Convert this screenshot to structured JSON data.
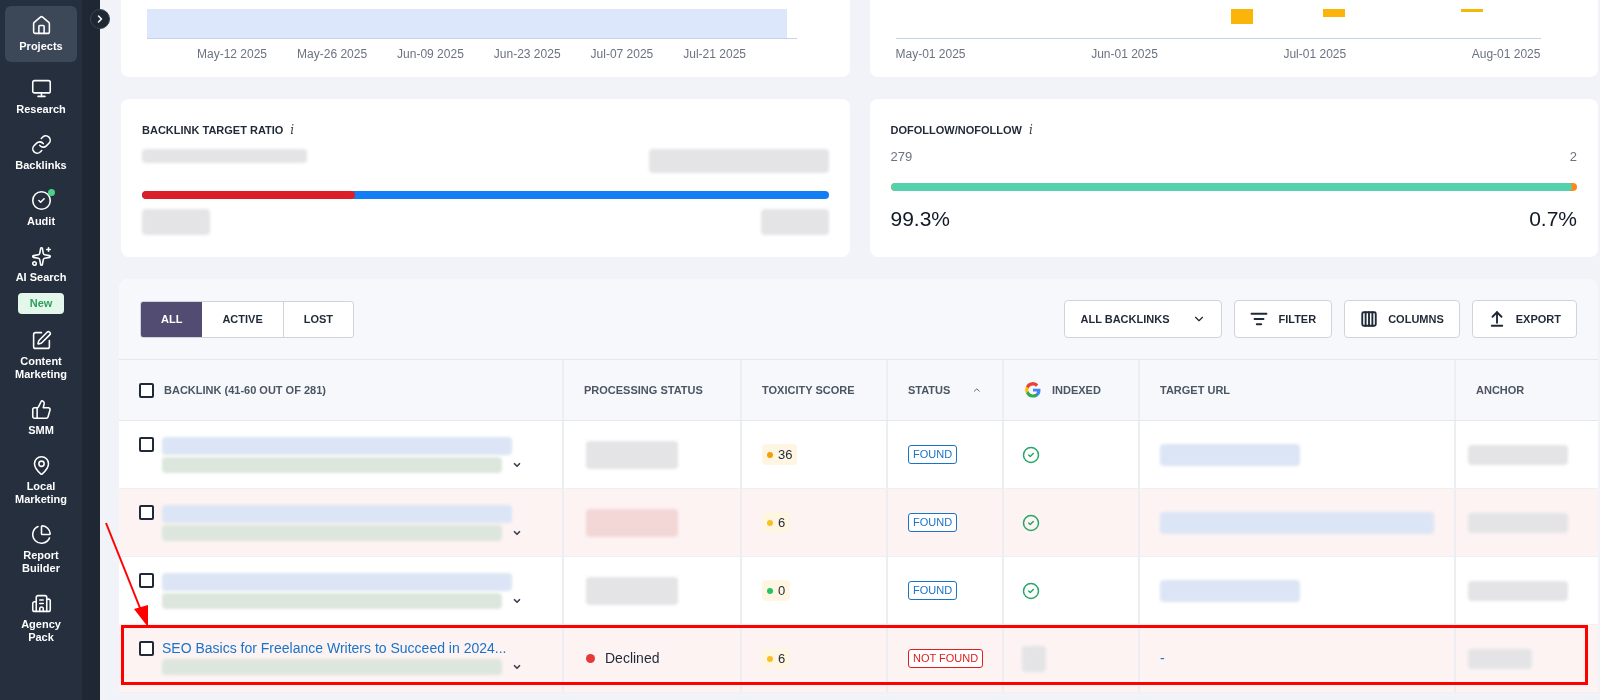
{
  "sidebar": {
    "items": [
      {
        "label": "Projects",
        "selected": true
      },
      {
        "label": "Research",
        "selected": false
      },
      {
        "label": "Backlinks",
        "selected": false
      },
      {
        "label": "Audit",
        "selected": false,
        "notification": true
      },
      {
        "label": "AI Search",
        "selected": false,
        "badge": "New"
      },
      {
        "label": "Content Marketing",
        "selected": false
      },
      {
        "label": "SMM",
        "selected": false
      },
      {
        "label": "Local Marketing",
        "selected": false
      },
      {
        "label": "Report Builder",
        "selected": false
      },
      {
        "label": "Agency Pack",
        "selected": false
      }
    ]
  },
  "top_charts": [
    {
      "kind": "area",
      "x_tick_labels": [
        "May-12 2025",
        "May-26 2025",
        "Jun-09 2025",
        "Jun-23 2025",
        "Jul-07 2025",
        "Jul-21 2025"
      ]
    },
    {
      "kind": "bars",
      "x_tick_labels": [
        "May-01 2025",
        "Jun-01 2025",
        "Jul-01 2025",
        "Aug-01 2025"
      ]
    }
  ],
  "ratio_cards": [
    {
      "title": "BACKLINK TARGET RATIO",
      "info": "i",
      "kind": "blurred",
      "level": 0.31
    },
    {
      "title": "DOFOLLOW/NOFOLLOW",
      "info": "i",
      "kind": "counts",
      "level": 0.993,
      "left_count": "279",
      "right_count": "2",
      "left_percent": "99.3%",
      "right_percent": "0.7%"
    }
  ],
  "segment_tabs": [
    {
      "label": "ALL",
      "selected": true
    },
    {
      "label": "ACTIVE",
      "selected": false
    },
    {
      "label": "LOST",
      "selected": false
    }
  ],
  "toolbar": {
    "dropdown": "ALL BACKLINKS",
    "buttons": [
      {
        "label": "FILTER",
        "kind": "filter"
      },
      {
        "label": "COLUMNS",
        "kind": "columns"
      },
      {
        "label": "EXPORT",
        "kind": "export"
      }
    ]
  },
  "table": {
    "columns": [
      {
        "label": "BACKLINK (41-60 OUT OF 281)",
        "kind": "select",
        "checked": false
      },
      {
        "label": "PROCESSING STATUS",
        "kind": "plain"
      },
      {
        "label": "TOXICITY SCORE",
        "kind": "plain"
      },
      {
        "label": "STATUS",
        "kind": "sorted"
      },
      {
        "label": "INDEXED",
        "kind": "google"
      },
      {
        "label": "TARGET URL",
        "kind": "plain"
      },
      {
        "label": "ANCHOR",
        "kind": "plain"
      }
    ],
    "rows": [
      {
        "checked": false,
        "tinted": false,
        "highlighted": false,
        "toxicity": {
          "value": "36",
          "color": "#f59e0b"
        },
        "status": {
          "label": "FOUND",
          "kind": "found"
        },
        "indexed": true
      },
      {
        "checked": false,
        "tinted": true,
        "highlighted": false,
        "toxicity": {
          "value": "6",
          "color": "#fbbf24"
        },
        "status": {
          "label": "FOUND",
          "kind": "found"
        },
        "indexed": true
      },
      {
        "checked": false,
        "tinted": false,
        "highlighted": false,
        "toxicity": {
          "value": "0",
          "color": "#22c55e"
        },
        "status": {
          "label": "FOUND",
          "kind": "found"
        },
        "indexed": true
      },
      {
        "checked": false,
        "tinted": true,
        "highlighted": true,
        "backlink_title": "SEO Basics for Freelance Writers to Succeed in 2024...",
        "processing": {
          "label": "Declined",
          "color": "#e53935"
        },
        "toxicity": {
          "value": "6",
          "color": "#fbbf24"
        },
        "status": {
          "label": "NOT FOUND",
          "kind": "not_found"
        },
        "indexed": false,
        "target_url": "-"
      }
    ]
  }
}
